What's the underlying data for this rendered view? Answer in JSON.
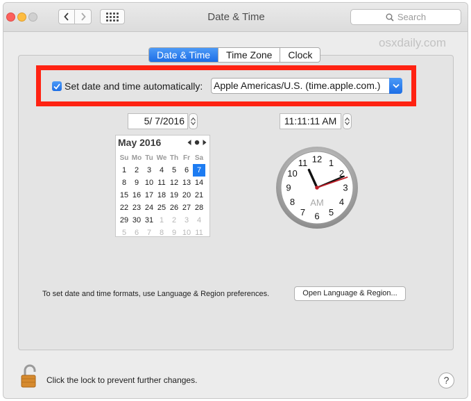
{
  "window": {
    "title": "Date & Time"
  },
  "toolbar": {
    "search_placeholder": "Search"
  },
  "watermark": "osxdaily.com",
  "tabs": [
    {
      "label": "Date & Time",
      "active": true
    },
    {
      "label": "Time Zone",
      "active": false
    },
    {
      "label": "Clock",
      "active": false
    }
  ],
  "auto_time": {
    "checked": true,
    "label": "Set date and time automatically:",
    "server": "Apple Americas/U.S. (time.apple.com.)"
  },
  "date_field": "5/  7/2016",
  "time_field": "11:11:11 AM",
  "calendar": {
    "month_label": "May 2016",
    "weekdays": [
      "Su",
      "Mo",
      "Tu",
      "We",
      "Th",
      "Fr",
      "Sa"
    ],
    "selected_day": "7",
    "weeks": [
      [
        "1",
        "2",
        "3",
        "4",
        "5",
        "6",
        "7"
      ],
      [
        "8",
        "9",
        "10",
        "11",
        "12",
        "13",
        "14"
      ],
      [
        "15",
        "16",
        "17",
        "18",
        "19",
        "20",
        "21"
      ],
      [
        "22",
        "23",
        "24",
        "25",
        "26",
        "27",
        "28"
      ],
      [
        "29",
        "30",
        "31",
        "1",
        "2",
        "3",
        "4"
      ],
      [
        "5",
        "6",
        "7",
        "8",
        "9",
        "10",
        "11"
      ]
    ],
    "next_month_start_week": 4,
    "next_month_start_col": 3
  },
  "clock": {
    "numbers": [
      "12",
      "1",
      "2",
      "3",
      "4",
      "5",
      "6",
      "7",
      "8",
      "9",
      "10",
      "11"
    ],
    "am_pm": "AM",
    "hour": 11,
    "minute": 11,
    "second": 11
  },
  "formats": {
    "text": "To set date and time formats, use Language & Region preferences.",
    "button_label": "Open Language & Region..."
  },
  "lock": {
    "message": "Click the lock to prevent further changes."
  },
  "help_label": "?",
  "colors": {
    "accent": "#1d6ee6",
    "highlight_box": "#ff2212",
    "second_hand": "#c0202a"
  }
}
